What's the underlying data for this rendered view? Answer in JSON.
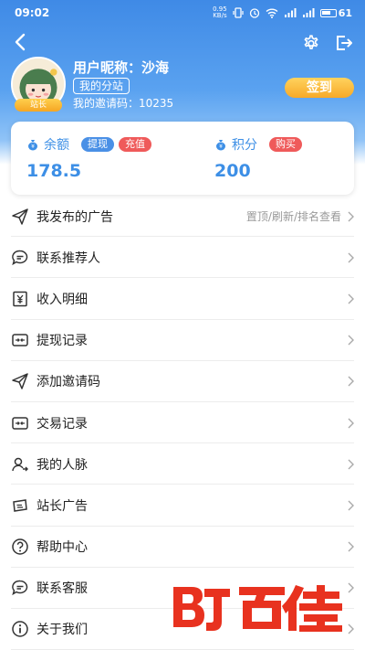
{
  "status_bar": {
    "time": "09:02",
    "net_speed_top": "0.95",
    "net_speed_bottom": "KB/s",
    "battery": "61"
  },
  "profile": {
    "nickname_label": "用户昵称：",
    "nickname": "沙海",
    "branch_button": "我的分站",
    "invite_label": "我的邀请码：",
    "invite_code": "10235",
    "role_badge": "站长",
    "checkin_button": "签到"
  },
  "wallet": {
    "balance_label": "余额",
    "withdraw_button": "提现",
    "recharge_button": "充值",
    "balance_value": "178.5",
    "points_label": "积分",
    "buy_button": "购买",
    "points_value": "200"
  },
  "menu": [
    {
      "label": "我发布的广告",
      "hint": "置顶/刷新/排名查看",
      "icon": "paper-plane-icon"
    },
    {
      "label": "联系推荐人",
      "hint": "",
      "icon": "chat-bubble-icon"
    },
    {
      "label": "收入明细",
      "hint": "",
      "icon": "yuan-icon"
    },
    {
      "label": "提现记录",
      "hint": "",
      "icon": "card-transfer-icon"
    },
    {
      "label": "添加邀请码",
      "hint": "",
      "icon": "paper-plane-icon"
    },
    {
      "label": "交易记录",
      "hint": "",
      "icon": "card-transfer-icon"
    },
    {
      "label": "我的人脉",
      "hint": "",
      "icon": "user-share-icon"
    },
    {
      "label": "站长广告",
      "hint": "",
      "icon": "ticket-icon"
    },
    {
      "label": "帮助中心",
      "hint": "",
      "icon": "question-icon"
    },
    {
      "label": "联系客服",
      "hint": "",
      "icon": "chat-bubble-icon"
    },
    {
      "label": "关于我们",
      "hint": "",
      "icon": "info-icon"
    }
  ],
  "colors": {
    "header_blue": "#3f8ae6",
    "accent_blue": "#3d8fe6",
    "accent_red": "#ef5a5a",
    "accent_gold": "#f7a928",
    "watermark_red": "#e8321f"
  }
}
